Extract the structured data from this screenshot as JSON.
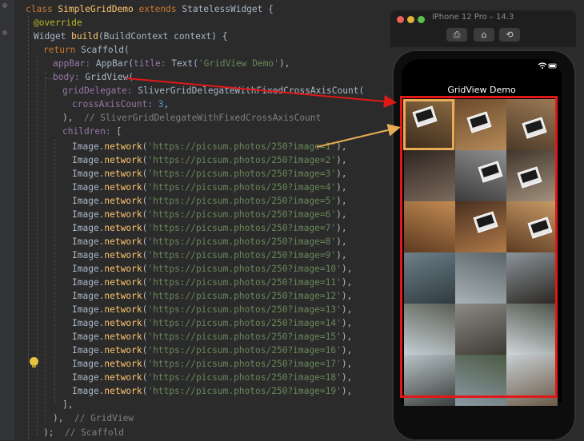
{
  "editor": {
    "lines": [
      {
        "segments": [
          [
            "kw",
            "class "
          ],
          [
            "cls",
            "SimpleGridDemo "
          ],
          [
            "kw",
            "extends "
          ],
          [
            "",
            "StatelessWidget {"
          ]
        ]
      },
      {
        "segments": [
          [
            "ann",
            "@override"
          ]
        ]
      },
      {
        "segments": [
          [
            "",
            "Widget "
          ],
          [
            "cls",
            "build"
          ],
          [
            "",
            "(BuildContext context) {"
          ]
        ]
      },
      {
        "segments": [
          [
            "kw",
            "return "
          ],
          [
            "",
            "Scaffold("
          ]
        ]
      },
      {
        "segments": [
          [
            "fld",
            "appBar: "
          ],
          [
            "",
            "AppBar("
          ],
          [
            "fld",
            "title: "
          ],
          [
            "",
            "Text("
          ],
          [
            "str",
            "'GridView Demo'"
          ],
          [
            "",
            "),"
          ]
        ]
      },
      {
        "segments": [
          [
            "fld",
            "body: "
          ],
          [
            "",
            "GridView("
          ]
        ]
      },
      {
        "segments": [
          [
            "fld",
            "gridDelegate: "
          ],
          [
            "",
            "SliverGridDelegateWithFixedCrossAxisCount("
          ]
        ]
      },
      {
        "segments": [
          [
            "fld",
            "crossAxisCount: "
          ],
          [
            "num",
            "3"
          ],
          [
            "",
            ","
          ]
        ]
      },
      {
        "segments": [
          [
            "",
            "),  "
          ],
          [
            "cmt",
            "// SliverGridDelegateWithFixedCrossAxisCount"
          ]
        ]
      },
      {
        "segments": [
          [
            "fld",
            "children: "
          ],
          [
            "",
            "["
          ]
        ]
      },
      {
        "segments": [
          [
            "",
            "Image."
          ],
          [
            "cls",
            "network"
          ],
          [
            "",
            "("
          ],
          [
            "str",
            "'https://picsum.photos/250?image=1'"
          ],
          [
            "",
            "),"
          ]
        ]
      },
      {
        "segments": [
          [
            "",
            "Image."
          ],
          [
            "cls",
            "network"
          ],
          [
            "",
            "("
          ],
          [
            "str",
            "'https://picsum.photos/250?image=2'"
          ],
          [
            "",
            "),"
          ]
        ]
      },
      {
        "segments": [
          [
            "",
            "Image."
          ],
          [
            "cls",
            "network"
          ],
          [
            "",
            "("
          ],
          [
            "str",
            "'https://picsum.photos/250?image=3'"
          ],
          [
            "",
            "),"
          ]
        ]
      },
      {
        "segments": [
          [
            "",
            "Image."
          ],
          [
            "cls",
            "network"
          ],
          [
            "",
            "("
          ],
          [
            "str",
            "'https://picsum.photos/250?image=4'"
          ],
          [
            "",
            "),"
          ]
        ]
      },
      {
        "segments": [
          [
            "",
            "Image."
          ],
          [
            "cls",
            "network"
          ],
          [
            "",
            "("
          ],
          [
            "str",
            "'https://picsum.photos/250?image=5'"
          ],
          [
            "",
            "),"
          ]
        ]
      },
      {
        "segments": [
          [
            "",
            "Image."
          ],
          [
            "cls",
            "network"
          ],
          [
            "",
            "("
          ],
          [
            "str",
            "'https://picsum.photos/250?image=6'"
          ],
          [
            "",
            "),"
          ]
        ]
      },
      {
        "segments": [
          [
            "",
            "Image."
          ],
          [
            "cls",
            "network"
          ],
          [
            "",
            "("
          ],
          [
            "str",
            "'https://picsum.photos/250?image=7'"
          ],
          [
            "",
            "),"
          ]
        ]
      },
      {
        "segments": [
          [
            "",
            "Image."
          ],
          [
            "cls",
            "network"
          ],
          [
            "",
            "("
          ],
          [
            "str",
            "'https://picsum.photos/250?image=8'"
          ],
          [
            "",
            "),"
          ]
        ]
      },
      {
        "segments": [
          [
            "",
            "Image."
          ],
          [
            "cls",
            "network"
          ],
          [
            "",
            "("
          ],
          [
            "str",
            "'https://picsum.photos/250?image=9'"
          ],
          [
            "",
            "),"
          ]
        ]
      },
      {
        "segments": [
          [
            "",
            "Image."
          ],
          [
            "cls",
            "network"
          ],
          [
            "",
            "("
          ],
          [
            "str",
            "'https://picsum.photos/250?image=10'"
          ],
          [
            "",
            "),"
          ]
        ]
      },
      {
        "segments": [
          [
            "",
            "Image."
          ],
          [
            "cls",
            "network"
          ],
          [
            "",
            "("
          ],
          [
            "str",
            "'https://picsum.photos/250?image=11'"
          ],
          [
            "",
            "),"
          ]
        ]
      },
      {
        "segments": [
          [
            "",
            "Image."
          ],
          [
            "cls",
            "network"
          ],
          [
            "",
            "("
          ],
          [
            "str",
            "'https://picsum.photos/250?image=12'"
          ],
          [
            "",
            "),"
          ]
        ]
      },
      {
        "segments": [
          [
            "",
            "Image."
          ],
          [
            "cls",
            "network"
          ],
          [
            "",
            "("
          ],
          [
            "str",
            "'https://picsum.photos/250?image=13'"
          ],
          [
            "",
            "),"
          ]
        ]
      },
      {
        "segments": [
          [
            "",
            "Image."
          ],
          [
            "cls",
            "network"
          ],
          [
            "",
            "("
          ],
          [
            "str",
            "'https://picsum.photos/250?image=14'"
          ],
          [
            "",
            "),"
          ]
        ]
      },
      {
        "segments": [
          [
            "",
            "Image."
          ],
          [
            "cls",
            "network"
          ],
          [
            "",
            "("
          ],
          [
            "str",
            "'https://picsum.photos/250?image=15'"
          ],
          [
            "",
            "),"
          ]
        ]
      },
      {
        "segments": [
          [
            "",
            "Image."
          ],
          [
            "cls",
            "network"
          ],
          [
            "",
            "("
          ],
          [
            "str",
            "'https://picsum.photos/250?image=16'"
          ],
          [
            "",
            "),"
          ]
        ]
      },
      {
        "segments": [
          [
            "",
            "Image."
          ],
          [
            "cls",
            "network"
          ],
          [
            "",
            "("
          ],
          [
            "str",
            "'https://picsum.photos/250?image=17'"
          ],
          [
            "",
            "),"
          ]
        ]
      },
      {
        "segments": [
          [
            "",
            "Image."
          ],
          [
            "cls",
            "network"
          ],
          [
            "",
            "("
          ],
          [
            "str",
            "'https://picsum.photos/250?image=18'"
          ],
          [
            "",
            "),"
          ]
        ]
      },
      {
        "segments": [
          [
            "",
            "Image."
          ],
          [
            "cls",
            "network"
          ],
          [
            "",
            "("
          ],
          [
            "str",
            "'https://picsum.photos/250?image=19'"
          ],
          [
            "",
            "),"
          ]
        ]
      },
      {
        "segments": [
          [
            "",
            "],"
          ]
        ]
      },
      {
        "segments": [
          [
            "",
            "),  "
          ],
          [
            "cmt",
            "// GridView"
          ]
        ]
      },
      {
        "segments": [
          [
            "",
            ");  "
          ],
          [
            "cmt",
            "// Scaffold"
          ]
        ]
      }
    ]
  },
  "simulator": {
    "title": "iPhone 12 Pro – 14.3",
    "buttons": [
      {
        "name": "screenshot-icon",
        "glyph": "⎙"
      },
      {
        "name": "home-icon",
        "glyph": "⌂"
      },
      {
        "name": "rotate-icon",
        "glyph": "⟲"
      }
    ],
    "status_icons": "wifi-icon battery-icon",
    "app_bar_title": "GridView Demo"
  },
  "grid": {
    "cross_axis_count": 3,
    "tiles": [
      {
        "image": "image=1",
        "colors": [
          "#3a2a1c",
          "#8a6a42"
        ],
        "laptop": true
      },
      {
        "image": "image=2",
        "colors": [
          "#6b4a2c",
          "#b58a58"
        ],
        "laptop": true
      },
      {
        "image": "image=3",
        "colors": [
          "#4d3a28",
          "#9c7a55"
        ],
        "laptop": true
      },
      {
        "image": "image=4",
        "colors": [
          "#2e2520",
          "#7b6a5c"
        ],
        "laptop": false
      },
      {
        "image": "image=5",
        "colors": [
          "#3b3b3b",
          "#8f8f8f"
        ],
        "laptop": true
      },
      {
        "image": "image=6",
        "colors": [
          "#40352c",
          "#a3927e"
        ],
        "laptop": true
      },
      {
        "image": "image=7",
        "colors": [
          "#5c3a20",
          "#c28a52"
        ],
        "laptop": false
      },
      {
        "image": "image=8",
        "colors": [
          "#4a3020",
          "#b07a48"
        ],
        "laptop": true
      },
      {
        "image": "image=9",
        "colors": [
          "#5e3c22",
          "#c69a66"
        ],
        "laptop": true
      },
      {
        "image": "image=10",
        "colors": [
          "#6e7f88",
          "#2f3b40"
        ],
        "laptop": false
      },
      {
        "image": "image=11",
        "colors": [
          "#a9b3b6",
          "#5b6468"
        ],
        "laptop": false
      },
      {
        "image": "image=12",
        "colors": [
          "#8c9499",
          "#2a2622"
        ],
        "laptop": false
      },
      {
        "image": "image=13",
        "colors": [
          "#c4cfd5",
          "#5a5e52"
        ],
        "laptop": false
      },
      {
        "image": "image=14",
        "colors": [
          "#8d8a85",
          "#3e3a34"
        ],
        "laptop": false
      },
      {
        "image": "image=15",
        "colors": [
          "#cfd7db",
          "#4b5348"
        ],
        "laptop": false
      },
      {
        "image": "image=16",
        "colors": [
          "#b7c2c6",
          "#3a3f3c"
        ],
        "laptop": false
      },
      {
        "image": "image=17",
        "colors": [
          "#8a9aa4",
          "#4d5a45"
        ],
        "laptop": false
      },
      {
        "image": "image=18",
        "colors": [
          "#c6ced2",
          "#6b5a48"
        ],
        "laptop": false
      }
    ]
  },
  "colors": {
    "highlight_red": "#e01818",
    "highlight_orange": "#e8ac56"
  }
}
